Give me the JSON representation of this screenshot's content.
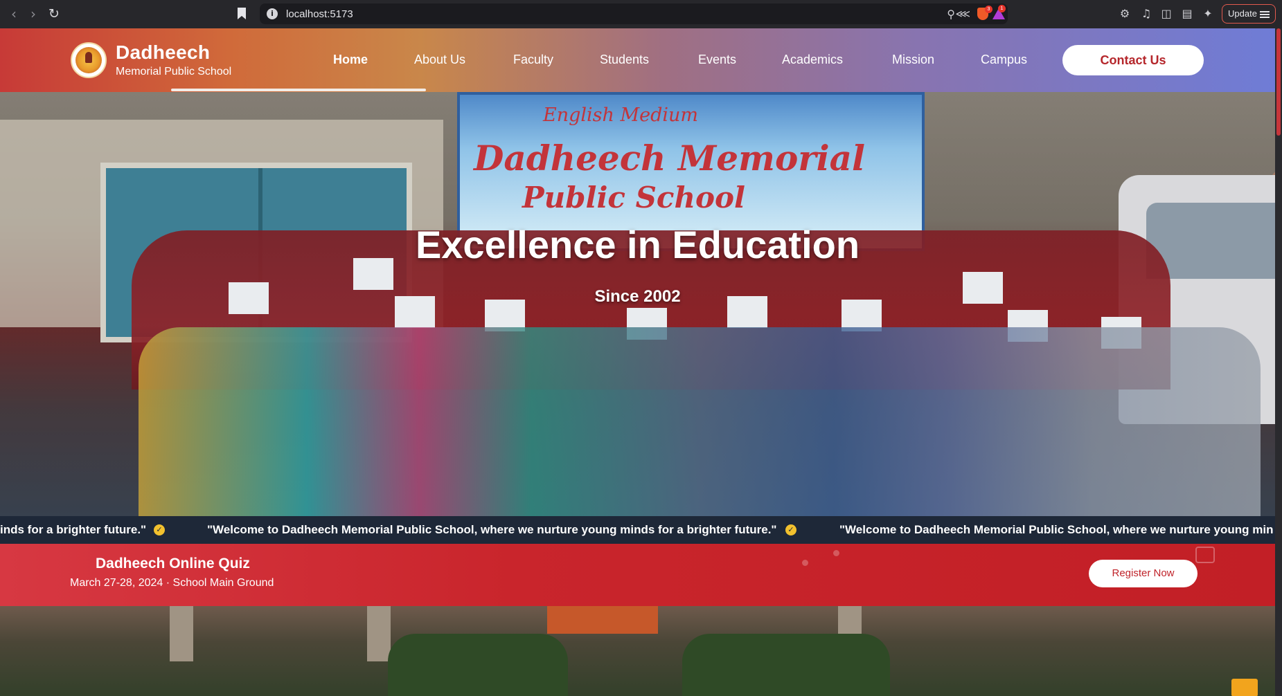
{
  "browser": {
    "url": "localhost:5173",
    "update_label": "Update",
    "shield_badge": "3",
    "rewards_badge": "1"
  },
  "header": {
    "brand_title": "Dadheech",
    "brand_subtitle": "Memorial Public School",
    "nav": [
      "Home",
      "About Us",
      "Faculty",
      "Students",
      "Events",
      "Academics",
      "Mission",
      "Campus"
    ],
    "active_nav": "Home",
    "contact_label": "Contact Us"
  },
  "hero": {
    "title": "Excellence in Education",
    "subtitle": "Since 2002",
    "banner_line1": "English Medium",
    "banner_line2": "Dadheech Memorial",
    "banner_line3": "Public School"
  },
  "ticker": {
    "fragment": "inds for a brighter future.\"",
    "message": "\"Welcome to Dadheech Memorial Public School, where we nurture young minds for a brighter future.\"",
    "message_cut": "\"Welcome to Dadheech Memorial Public School, where we nurture young min"
  },
  "event": {
    "title": "Dadheech Online Quiz",
    "meta": "March 27-28, 2024 · School Main Ground",
    "register_label": "Register Now"
  },
  "colors": {
    "brand_red": "#c0232a",
    "ticker_bg": "#1e2838",
    "check_yellow": "#f2c12e"
  }
}
